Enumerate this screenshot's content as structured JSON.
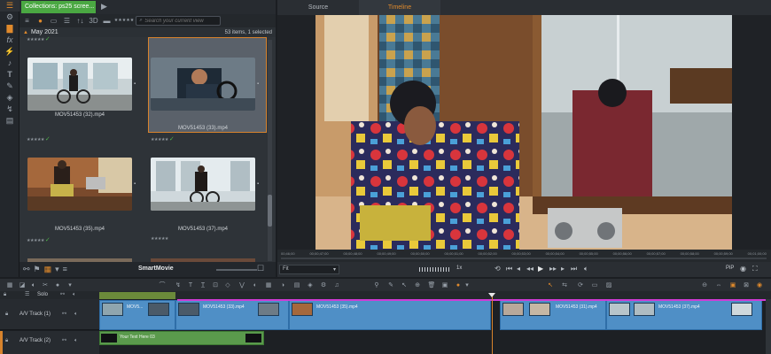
{
  "library": {
    "collection_tab": "Collections: ps25 scree...",
    "search_placeholder": "Search your current view",
    "group_title": "May 2021",
    "item_count": "53 items, 1 selected",
    "smartmovie_label": "SmartMovie",
    "clips": [
      {
        "name": "MOV51453 (32).mp4",
        "selected": false
      },
      {
        "name": "MOV51453 (33).mp4",
        "selected": true
      },
      {
        "name": "MOV51453 (35).mp4",
        "selected": false
      },
      {
        "name": "MOV51453 (37).mp4",
        "selected": false
      }
    ],
    "toolbar_3d": "3D",
    "toolbar_sort": "↑↓"
  },
  "player": {
    "tabs": [
      "Source",
      "Timeline"
    ],
    "active_tab": "Timeline",
    "fit": "Fit",
    "speed": "1x",
    "pip": "PiP",
    "scrub_labels": [
      "00;46;00",
      "00;00;47;00",
      "00;00;48;00",
      "00;00;49;00",
      "00;00;50;00",
      "00;00;51;00",
      "00;00;52;00",
      "00;00;53;00",
      "00;00;54;00",
      "00;00;55;00",
      "00;00;56;00",
      "00;00;57;00",
      "00;00;58;00",
      "00;00;59;00",
      "00;01;00;00"
    ]
  },
  "timeline": {
    "solo": "Solo",
    "tracks": [
      {
        "name": "A/V Track (1)"
      },
      {
        "name": "A/V Track (2)"
      }
    ],
    "clips": [
      {
        "label": "MOV5..."
      },
      {
        "label": "MOV51453 (33).mp4"
      },
      {
        "label": "MOV51453 (35).mp4"
      },
      {
        "label": "MOV51453 (31).mp4"
      },
      {
        "label": "MOV51453 (37).mp4"
      }
    ],
    "title_clip": "Your Text Here 03"
  },
  "colors": {
    "accent": "#e08a2c",
    "collection_green": "#4aa842",
    "clip_blue": "#4f8fc6",
    "title_green": "#5a9a4c",
    "selection": "#d13bd5"
  }
}
